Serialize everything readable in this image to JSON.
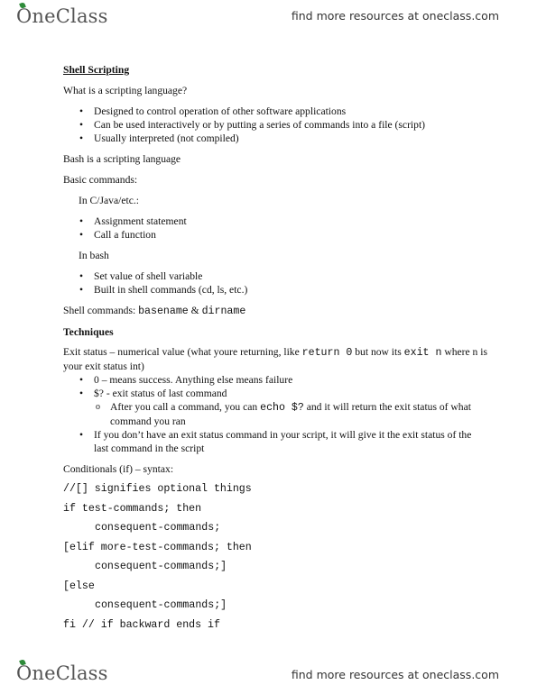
{
  "header": {
    "brand": "OneClass",
    "brand_rest": "neClass",
    "brand_first": "O",
    "tagline": "find more resources at oneclass.com"
  },
  "footer": {
    "brand_first": "O",
    "brand_rest": "neClass",
    "tagline": "find more resources at oneclass.com"
  },
  "colors": {
    "brand_green": "#2e8b3a",
    "brand_gray": "#555555"
  },
  "doc": {
    "title": "Shell Scripting",
    "q1": "What is a scripting language?",
    "q1_bullets": [
      "Designed to control operation of other software applications",
      "Can be used interactively or by putting a series of commands into a file (script)",
      "Usually interpreted (not compiled)"
    ],
    "bash_line": "Bash is a scripting language",
    "basic_commands": "Basic commands:",
    "in_c": "In C/Java/etc.:",
    "c_bullets": [
      "Assignment statement",
      "Call a function"
    ],
    "in_bash": "In bash",
    "bash_bullets": [
      "Set value of shell variable",
      "Built in shell commands (cd, ls, etc.)"
    ],
    "shell_cmds_label": "Shell commands: ",
    "shell_cmd_1": "basename",
    "shell_cmds_amp": " & ",
    "shell_cmd_2": "dirname",
    "techniques": "Techniques",
    "exit_p1": "Exit status – numerical value (what youre returning, like ",
    "exit_code1": "return 0",
    "exit_p2": " but now its ",
    "exit_code2": "exit n",
    "exit_p3": " where n is your exit status int)",
    "exit_bullet_1": "0 – means success. Anything else means failure",
    "exit_bullet_2": "$? - exit status of last command",
    "exit_sub_p1": "After you call a command, you can ",
    "exit_sub_code": "echo $?",
    "exit_sub_p2": " and it will return the exit status of what command you ran",
    "exit_bullet_3": "If you don’t have an exit status command in your script, it will give it the exit status of the last command in the script",
    "conditionals": "Conditionals (if) – syntax:",
    "code_lines": [
      "//[] signifies optional things",
      "if test-commands; then",
      "consequent-commands;",
      "[elif more-test-commands; then",
      "consequent-commands;]",
      "[else",
      "consequent-commands;]",
      "fi // if backward ends if"
    ]
  }
}
